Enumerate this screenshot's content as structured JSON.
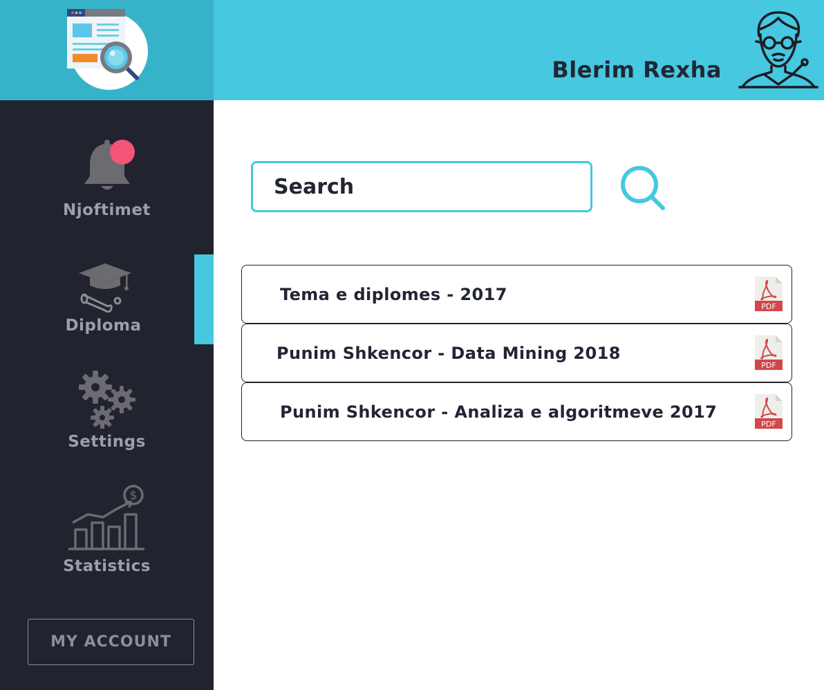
{
  "header": {
    "user_name": "Blerim Rexha"
  },
  "sidebar": {
    "items": [
      {
        "label": "Njoftimet",
        "icon": "bell-icon"
      },
      {
        "label": "Diploma",
        "icon": "graduation-cap-icon"
      },
      {
        "label": "Settings",
        "icon": "gears-icon"
      },
      {
        "label": "Statistics",
        "icon": "statistics-chart-icon"
      }
    ],
    "active": "Diploma",
    "account_button": "MY ACCOUNT"
  },
  "search": {
    "placeholder": "Search"
  },
  "documents": [
    {
      "title": "Tema e diplomes - 2017",
      "file_type": "PDF"
    },
    {
      "title": "Punim Shkencor - Data Mining 2018",
      "file_type": "PDF"
    },
    {
      "title": "Punim Shkencor - Analiza e algoritmeve 2017",
      "file_type": "PDF"
    }
  ],
  "colors": {
    "accent": "#45c8e0",
    "sidebar_bg": "#21232f",
    "notification_dot": "#f25575",
    "pdf_red": "#d0484a"
  }
}
